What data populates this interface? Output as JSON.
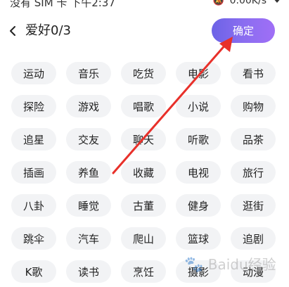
{
  "status_bar": {
    "carrier": "没有 SIM 卡 下午2:37",
    "speed": "0.00K/s",
    "icons": [
      "bell-mute-icon",
      "wifi-icon"
    ]
  },
  "nav": {
    "title": "爱好0/3",
    "confirm_label": "确定",
    "back_icon": "chevron-left-icon"
  },
  "tags": [
    "运动",
    "音乐",
    "吃货",
    "电影",
    "看书",
    "探险",
    "游戏",
    "唱歌",
    "小说",
    "购物",
    "追星",
    "交友",
    "聊天",
    "听歌",
    "品茶",
    "插画",
    "养鱼",
    "收藏",
    "电视",
    "旅行",
    "八卦",
    "睡觉",
    "古董",
    "健身",
    "逛街",
    "跳伞",
    "汽车",
    "爬山",
    "篮球",
    "追剧",
    "K歌",
    "读书",
    "烹饪",
    "摄影",
    "动漫"
  ],
  "watermark": "Baidu经验",
  "colors": {
    "accent_start": "#6c63e6",
    "accent_end": "#a06ff6",
    "tag_bg": "#f2f3f5",
    "arrow": "#e8302a"
  }
}
